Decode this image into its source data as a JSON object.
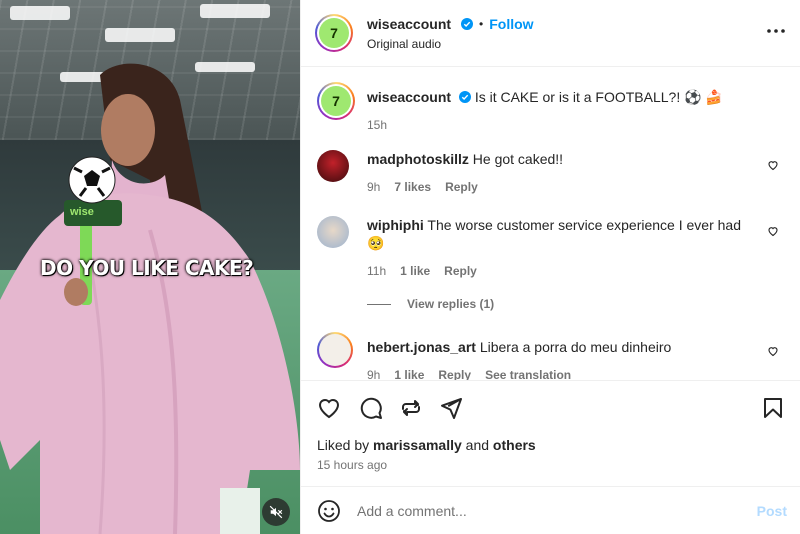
{
  "post": {
    "video_overlay_text": "DO YOU LIKE CAKE?",
    "mic_brand": "wise",
    "mute_icon": "volume-muted-icon"
  },
  "header": {
    "username": "wiseaccount",
    "separator": "•",
    "follow_label": "Follow",
    "audio_label": "Original audio",
    "more_icon": "more-horizontal-icon"
  },
  "caption": {
    "username": "wiseaccount",
    "text": "Is it CAKE or is it a FOOTBALL?! ⚽ 🍰",
    "time": "15h"
  },
  "comments": [
    {
      "username": "madphotoskillz",
      "text": "He got caked!!",
      "time": "9h",
      "likes": "7 likes",
      "reply": "Reply"
    },
    {
      "username": "wiphiphi",
      "text": "The worse customer service experience I ever had 🥺",
      "time": "11h",
      "likes": "1 like",
      "reply": "Reply"
    },
    {
      "username": "hebert.jonas_art",
      "text": "Libera a porra do meu dinheiro",
      "time": "9h",
      "likes": "1 like",
      "reply": "Reply",
      "translate": "See translation"
    }
  ],
  "view_replies": "View replies (1)",
  "actions": {
    "liked_prefix": "Liked by",
    "liked_user": "marissamally",
    "liked_and": "and",
    "liked_others": "others",
    "timestamp": "15 hours ago"
  },
  "add_comment": {
    "placeholder": "Add a comment...",
    "post_label": "Post"
  },
  "colors": {
    "brand_green": "#9fe870",
    "link_blue": "#0095f6",
    "post_disabled": "#b3dbff"
  }
}
